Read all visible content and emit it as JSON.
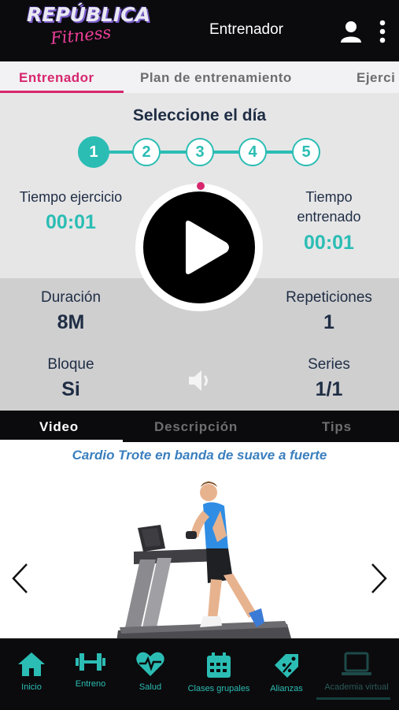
{
  "app": {
    "logo_main": "REPÚBLICA",
    "logo_sub": "Fitness",
    "header_title": "Entrenador",
    "icons": {
      "user": "user-icon",
      "more": "more-vertical-icon"
    },
    "colors": {
      "accent": "#d7276e",
      "teal": "#2bbdb4",
      "dark": "#0b0b0d",
      "text": "#1f2d44"
    }
  },
  "tabs": [
    {
      "label": "Entrenador",
      "active": true
    },
    {
      "label": "Plan de entrenamiento",
      "active": false
    },
    {
      "label": "Ejerci",
      "active": false
    }
  ],
  "day_selector": {
    "label": "Seleccione el día",
    "days": [
      "1",
      "2",
      "3",
      "4",
      "5"
    ],
    "selected": "1"
  },
  "timers": {
    "exercise_time_label": "Tiempo ejercicio",
    "exercise_time_value": "00:01",
    "trained_time_label_1": "Tiempo",
    "trained_time_label_2": "entrenado",
    "trained_time_value": "00:01"
  },
  "info": {
    "duration_label": "Duración",
    "duration_value": "8M",
    "reps_label": "Repeticiones",
    "reps_value": "1",
    "block_label": "Bloque",
    "block_value": "Si",
    "series_label": "Series",
    "series_value": "1/1"
  },
  "media_tabs": [
    {
      "label": "Video",
      "active": true
    },
    {
      "label": "Descripción",
      "active": false
    },
    {
      "label": "Tips",
      "active": false
    }
  ],
  "exercise": {
    "title": "Cardio Trote en banda de suave a fuerte"
  },
  "bottom_nav": [
    {
      "label": "Inicio",
      "icon": "home-icon"
    },
    {
      "label": "Entreno",
      "icon": "dumbbell-icon"
    },
    {
      "label": "Salud",
      "icon": "heart-pulse-icon"
    },
    {
      "label": "Clases grupales",
      "icon": "calendar-icon"
    },
    {
      "label": "Alianzas",
      "icon": "tag-percent-icon"
    },
    {
      "label": "Academia virtual",
      "icon": "laptop-icon"
    }
  ]
}
